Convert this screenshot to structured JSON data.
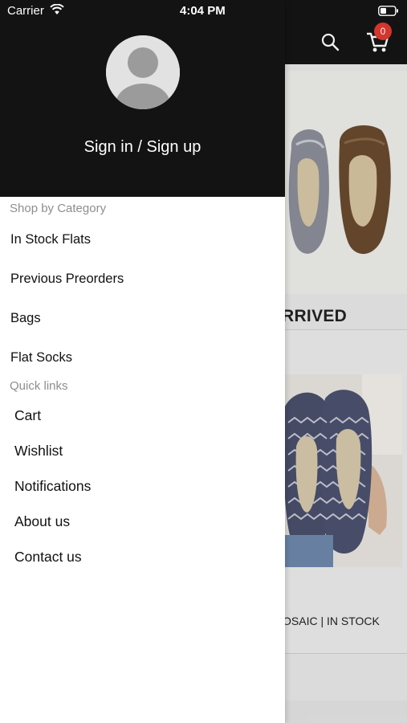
{
  "status_bar": {
    "carrier": "Carrier",
    "time": "4:04 PM"
  },
  "background": {
    "cart_count": "0",
    "section_heading": "RRIVED",
    "product_caption": "OSAIC | IN STOCK"
  },
  "drawer": {
    "signin_label": "Sign in / Sign up",
    "shop_section_label": "Shop by Category",
    "categories": [
      "In Stock Flats",
      "Previous Preorders",
      "Bags",
      "Flat Socks"
    ],
    "quick_section_label": "Quick links",
    "quick_links": [
      "Cart",
      "Wishlist",
      "Notifications",
      "About us",
      "Contact us"
    ]
  },
  "colors": {
    "header_bg": "#131313",
    "badge": "#e03a2f",
    "muted_text": "#8e8e8e"
  }
}
